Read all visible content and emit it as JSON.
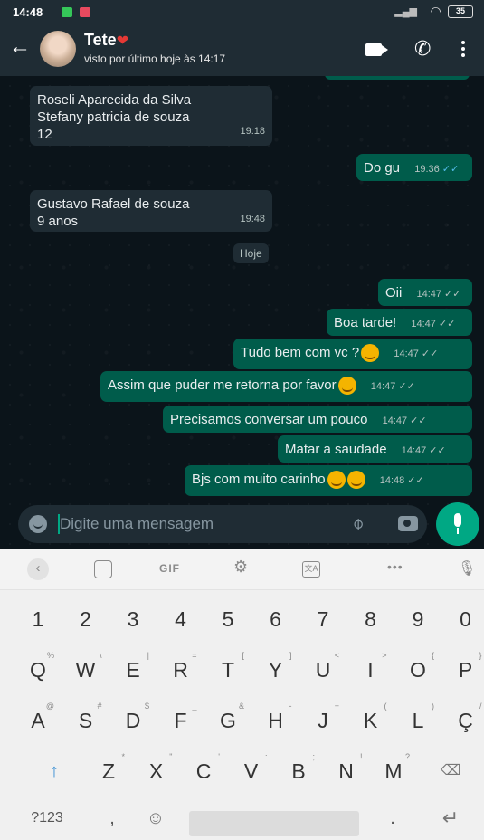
{
  "status_bar": {
    "time": "14:48",
    "battery": "35"
  },
  "header": {
    "contact_name": "Tete",
    "last_seen": "visto por último hoje às 14:17"
  },
  "chat": {
    "date_chip": "Hoje",
    "messages": [
      {
        "dir": "in",
        "text_lines": [
          "Roseli Aparecida da Silva",
          "Stefany patricia de souza",
          "12"
        ],
        "time": "19:18"
      },
      {
        "dir": "out",
        "text": "Do gu",
        "time": "19:36"
      },
      {
        "dir": "in",
        "text_lines": [
          "Gustavo Rafael de souza",
          "9 anos"
        ],
        "time": "19:48"
      },
      {
        "dir": "out",
        "text": "Oii",
        "time": "14:47"
      },
      {
        "dir": "out",
        "text": "Boa tarde!",
        "time": "14:47"
      },
      {
        "dir": "out",
        "text": "Tudo bem com vc ?",
        "time": "14:47"
      },
      {
        "dir": "out",
        "text": "Assim que puder me retorna por favor",
        "time": "14:47"
      },
      {
        "dir": "out",
        "text": "Precisamos conversar um pouco",
        "time": "14:47"
      },
      {
        "dir": "out",
        "text": "Matar a saudade",
        "time": "14:47"
      },
      {
        "dir": "out",
        "text": "Bjs com muito carinho",
        "time": "14:48"
      }
    ]
  },
  "compose": {
    "placeholder": "Digite uma mensagem"
  },
  "keyboard": {
    "toolbar": {
      "gif": "GIF",
      "more": "•••"
    },
    "number_row": [
      "1",
      "2",
      "3",
      "4",
      "5",
      "6",
      "7",
      "8",
      "9",
      "0"
    ],
    "row1": [
      {
        "k": "Q",
        "s": "%"
      },
      {
        "k": "W",
        "s": "\\"
      },
      {
        "k": "E",
        "s": "|"
      },
      {
        "k": "R",
        "s": "="
      },
      {
        "k": "T",
        "s": "["
      },
      {
        "k": "Y",
        "s": "]"
      },
      {
        "k": "U",
        "s": "<"
      },
      {
        "k": "I",
        "s": ">"
      },
      {
        "k": "O",
        "s": "{"
      },
      {
        "k": "P",
        "s": "}"
      }
    ],
    "row2": [
      {
        "k": "A",
        "s": "@"
      },
      {
        "k": "S",
        "s": "#"
      },
      {
        "k": "D",
        "s": "$"
      },
      {
        "k": "F",
        "s": "_"
      },
      {
        "k": "G",
        "s": "&"
      },
      {
        "k": "H",
        "s": "-"
      },
      {
        "k": "J",
        "s": "+"
      },
      {
        "k": "K",
        "s": "("
      },
      {
        "k": "L",
        "s": ")"
      },
      {
        "k": "Ç",
        "s": "/"
      }
    ],
    "row3": [
      {
        "k": "Z",
        "s": "*"
      },
      {
        "k": "X",
        "s": "\""
      },
      {
        "k": "C",
        "s": "'"
      },
      {
        "k": "V",
        "s": ":"
      },
      {
        "k": "B",
        "s": ";"
      },
      {
        "k": "N",
        "s": "!"
      },
      {
        "k": "M",
        "s": "?"
      }
    ],
    "sym_label": "?123",
    "comma": ",",
    "period": "."
  },
  "colors": {
    "header_bg": "#1f2c34",
    "chat_bg": "#0b141a",
    "incoming_bubble": "#1f2c34",
    "outgoing_bubble": "#005c4b",
    "accent": "#00a884",
    "read_tick": "#53bdeb"
  }
}
